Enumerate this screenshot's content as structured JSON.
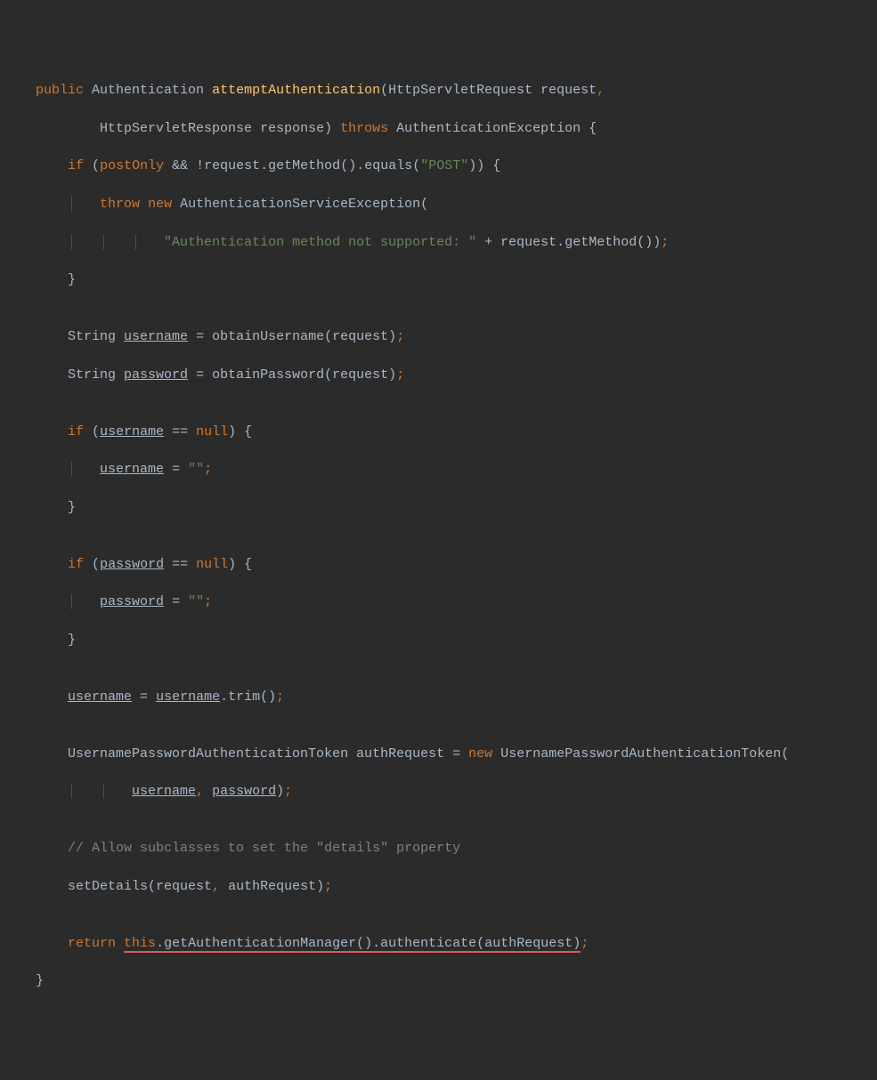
{
  "code": {
    "line1": {
      "kw_public": "public",
      "type_auth": "Authentication",
      "method": "attemptAuthentication",
      "type_req": "HttpServletRequest",
      "param_req": "request",
      "comma": ","
    },
    "line2": {
      "type_resp": "HttpServletResponse",
      "param_resp": "response",
      "paren": ")",
      "kw_throws": "throws",
      "type_exc": "AuthenticationException",
      "brace": "{"
    },
    "line3": {
      "kw_if": "if",
      "paren_open": "(",
      "var_postonly": "postOnly",
      "op_and": "&&",
      "op_not": "!",
      "var_req": "request",
      "dot1": ".",
      "m_getmethod": "getMethod",
      "parens1": "()",
      "dot2": ".",
      "m_equals": "equals",
      "paren_open2": "(",
      "str_post": "\"POST\"",
      "close": "))",
      "brace": "{"
    },
    "line4": {
      "kw_throw": "throw",
      "kw_new": "new",
      "type_ase": "AuthenticationServiceException",
      "paren": "("
    },
    "line5": {
      "str_msg": "\"Authentication method not supported: \"",
      "op_plus": "+",
      "var_req": "request",
      "dot": ".",
      "m_getmethod": "getMethod",
      "close": "());"
    },
    "line6": {
      "brace": "}"
    },
    "line7": {
      "type_string": "String",
      "var_username": "username",
      "op_eq": "=",
      "m_obtain": "obtainUsername",
      "paren_open": "(",
      "var_req": "request",
      "close": ");"
    },
    "line8": {
      "type_string": "String",
      "var_password": "password",
      "op_eq": "=",
      "m_obtain": "obtainPassword",
      "paren_open": "(",
      "var_req": "request",
      "close": ");"
    },
    "line9": {
      "kw_if": "if",
      "paren_open": "(",
      "var_username": "username",
      "op_eq": "==",
      "kw_null": "null",
      "close": ")",
      "brace": "{"
    },
    "line10": {
      "var_username": "username",
      "op_eq": "=",
      "str_empty": "\"\"",
      "semi": ";"
    },
    "line11": {
      "brace": "}"
    },
    "line12": {
      "kw_if": "if",
      "paren_open": "(",
      "var_password": "password",
      "op_eq": "==",
      "kw_null": "null",
      "close": ")",
      "brace": "{"
    },
    "line13": {
      "var_password": "password",
      "op_eq": "=",
      "str_empty": "\"\"",
      "semi": ";"
    },
    "line14": {
      "brace": "}"
    },
    "line15": {
      "var_username1": "username",
      "op_eq": "=",
      "var_username2": "username",
      "dot": ".",
      "m_trim": "trim",
      "close": "();"
    },
    "line16": {
      "type_upat": "UsernamePasswordAuthenticationToken",
      "var_authreq": "authRequest",
      "op_eq": "=",
      "kw_new": "new",
      "type_upat2": "UsernamePasswordAuthenticationToken",
      "paren": "("
    },
    "line17": {
      "var_username": "username",
      "comma": ",",
      "var_password": "password",
      "close": ");"
    },
    "line18": {
      "comment": "// Allow subclasses to set the \"details\" property"
    },
    "line19": {
      "m_setdetails": "setDetails",
      "paren_open": "(",
      "var_req": "request",
      "comma": ",",
      "var_authreq": "authRequest",
      "close": ");"
    },
    "line20": {
      "kw_return": "return",
      "kw_this": "this",
      "dot1": ".",
      "m_getam": "getAuthenticationManager",
      "parens1": "()",
      "dot2": ".",
      "m_auth": "authenticate",
      "paren_open": "(",
      "var_authreq": "authRequest",
      "close": ");"
    },
    "line21": {
      "brace": "}"
    }
  }
}
